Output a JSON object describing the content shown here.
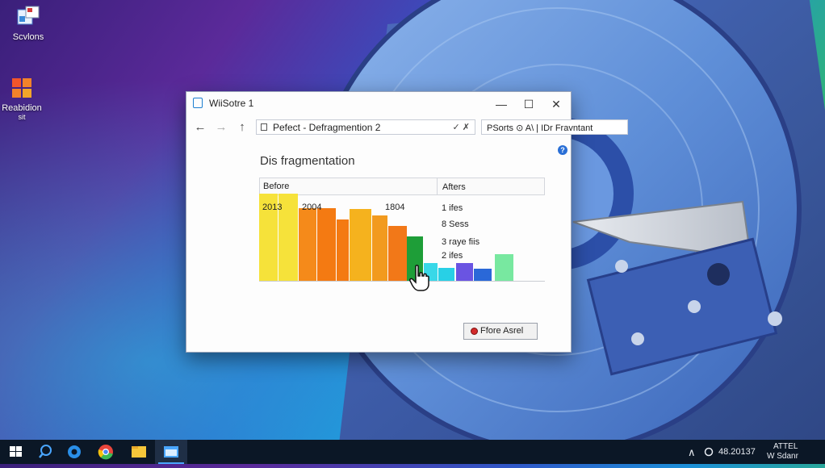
{
  "desktop": {
    "icons": [
      {
        "label": "Scvlons"
      },
      {
        "label": "Reabidion",
        "sublabel": "sit"
      }
    ]
  },
  "window": {
    "title": "WiiSotre 1",
    "controls": {
      "minimize": "—",
      "maximize": "☐",
      "close": "✕"
    },
    "nav": {
      "back": "←",
      "forward": "→",
      "up": "↑"
    },
    "address": {
      "text": "Pefect - Defragmention 2",
      "tail": "✓ ✗"
    },
    "search": {
      "text": "PSorts ⊙ A\\ | IDr Fravntant"
    },
    "help": "?",
    "heading": "Dis fragmentation",
    "table": {
      "before_label": "Before",
      "after_label": "Afters",
      "years": [
        "2013",
        "2004",
        "1804"
      ],
      "after_items": [
        "1 ifes",
        "8 Sess",
        "3 raye fiis",
        "2 ifes"
      ]
    },
    "chart_data": {
      "type": "bar",
      "values": [
        100,
        100,
        83,
        83,
        70,
        82,
        75,
        63,
        51,
        20,
        15,
        20,
        14,
        14,
        31
      ],
      "colors": [
        "#f6e23a",
        "#f6e23a",
        "#f58a1a",
        "#f47a12",
        "#f47a12",
        "#f5b21e",
        "#f29a1e",
        "#f27818",
        "#1e9e38",
        "#38d8e8",
        "#28d0e6",
        "#6a54e2",
        "#2a68d8",
        "#88e8a8",
        "#78e8a0"
      ],
      "ylim": [
        0,
        100
      ]
    },
    "action_button": "Ffore Asrel"
  },
  "taskbar": {
    "tray": {
      "chevron": "∧",
      "time": "48.20137",
      "right_line1": "ATTEL",
      "right_line2": "W Sdanr"
    }
  }
}
